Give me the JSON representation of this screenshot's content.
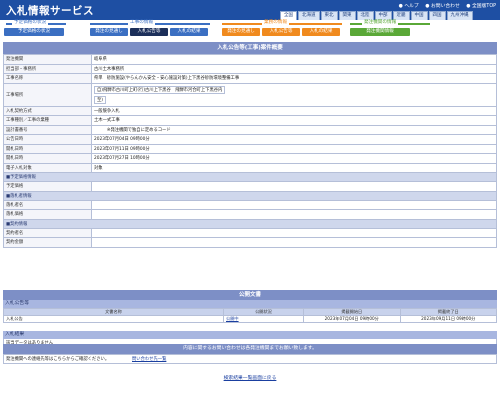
{
  "header": {
    "title": "入札情報サービス",
    "top_links": [
      "● ヘルプ",
      "● お問い合わせ",
      "● 全国版TOP"
    ],
    "regions": [
      "全国",
      "北海道",
      "東北",
      "関東",
      "北陸",
      "中部",
      "近畿",
      "中国",
      "四国",
      "九州沖縄"
    ],
    "categories": [
      {
        "label": "工事の情報",
        "color": "#3b6fc2"
      },
      {
        "label": "業務の情報",
        "color": "#f08a1e"
      },
      {
        "label": "発注機関の情報",
        "color": "#5aa837"
      }
    ],
    "sub_label": "予定価格の状況",
    "nav_buttons": [
      {
        "label": "予定価格の状況",
        "style": "blue"
      },
      {
        "label": "発注の見通し",
        "style": "blue"
      },
      {
        "label": "入札公告等",
        "style": "active"
      },
      {
        "label": "入札の結果",
        "style": "blue"
      },
      {
        "label": "発注の見通し",
        "style": "orange"
      },
      {
        "label": "入札公告等",
        "style": "orange"
      },
      {
        "label": "入札の結果",
        "style": "orange"
      },
      {
        "label": "発注機関情報",
        "style": "green"
      }
    ]
  },
  "detail": {
    "title": "入札公告等(工事)案件概要",
    "rows": [
      {
        "label": "発注機関",
        "value": "岐阜県"
      },
      {
        "label": "担当部・事務所",
        "value": "古川土木事務所"
      },
      {
        "label": "工事名称",
        "value": "県単　砂防施設(やらんかん安全・安心施設対策)上下黒谷砂防環境整備工事"
      },
      {
        "label": "工事場所",
        "value": "自)飛騨市古川町上町(行)古川上下黒谷　飛騨市河合町上下黒谷内",
        "extra": "至)"
      },
      {
        "label": "入札契約方式",
        "value": "一般競争入札"
      },
      {
        "label": "工事種別／工事の業種",
        "value": "土木一式工事"
      },
      {
        "label": "設計書番号",
        "value": "　　　※発注機関で独自に定めるコード"
      },
      {
        "label": "公告日時",
        "value": "2023年07月04日 09時00分"
      },
      {
        "label": "開札日時",
        "value": "2023年07月11日 09時00分"
      },
      {
        "label": "開札日時",
        "value": "2023年07月27日 10時00分"
      },
      {
        "label": "電子入札対象",
        "value": "対象"
      }
    ],
    "groups": [
      {
        "title": "■予定価格情報",
        "rows": [
          {
            "label": "予定価格",
            "value": ""
          }
        ]
      },
      {
        "title": "■落札者情報",
        "rows": [
          {
            "label": "落札者名",
            "value": ""
          },
          {
            "label": "落札価格",
            "value": ""
          }
        ]
      },
      {
        "title": "■契約情報",
        "rows": [
          {
            "label": "契約者名",
            "value": ""
          },
          {
            "label": "契約金額",
            "value": ""
          }
        ]
      }
    ]
  },
  "docs": {
    "title": "公開文書",
    "sub_title": "入札公告等",
    "columns": [
      "文書名称",
      "公開状況",
      "掲載開始日",
      "掲載終了日"
    ],
    "rows": [
      {
        "name": "入札公告",
        "status": "公開中",
        "start": "2023年07月04日 09時00分",
        "end": "2023年09月11日 09時00分"
      }
    ],
    "sub_title2": "入札結果",
    "empty_note": "該当データはありません"
  },
  "inquiry": {
    "bar": "内容に関するお問い合わせは各発注機関までお願い致します。",
    "row_label": "発注機関への連絡先等はこちらからご確認ください。",
    "row_link": "問い合わせ先一覧"
  },
  "footer": {
    "back_link": "検索結果一覧画面に戻る"
  }
}
